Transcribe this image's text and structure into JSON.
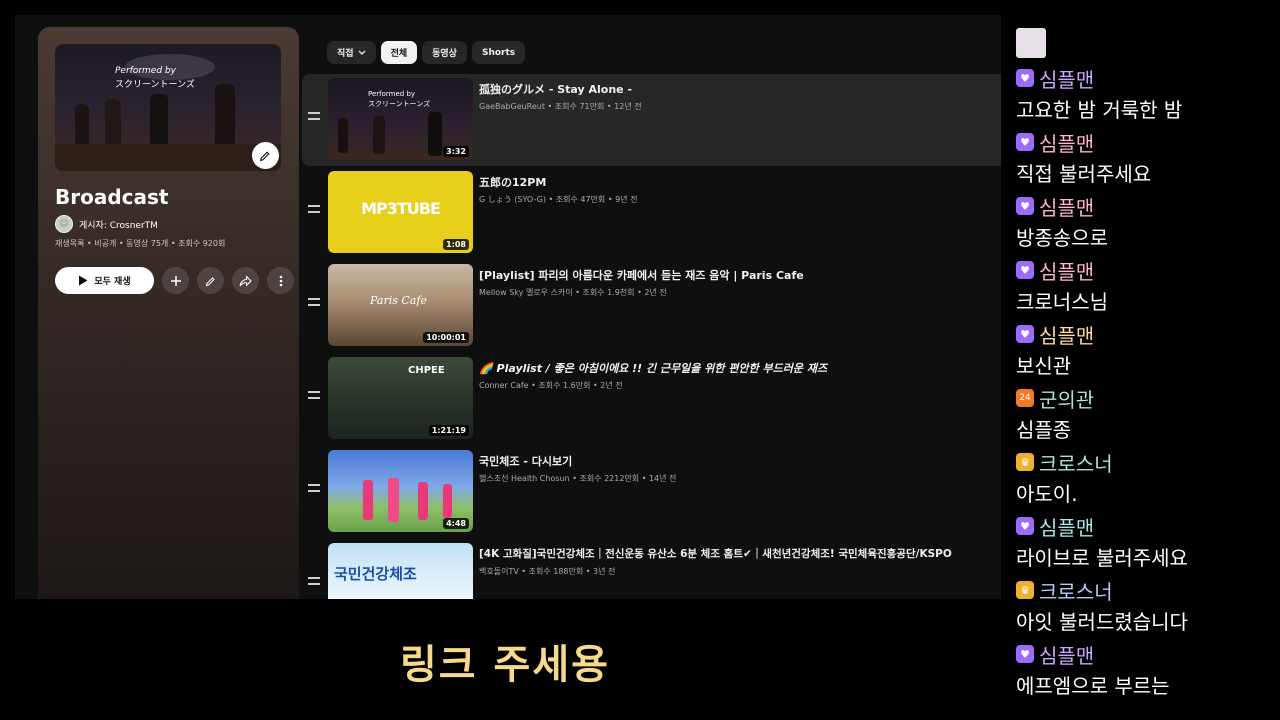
{
  "playlist": {
    "title": "Broadcast",
    "owner": "게시자: CrosnerTM",
    "meta": "재생목록 • 비공개 • 동영상 75개 • 조회수 920회",
    "play_all_label": "모두 재생"
  },
  "chips": [
    {
      "label": "직접"
    },
    {
      "label": "전체"
    },
    {
      "label": "동영상"
    },
    {
      "label": "Shorts"
    }
  ],
  "videos": [
    {
      "title": "孤独のグルメ - Stay Alone -",
      "meta": "GaeBabGeuReut • 조회수 71만회 • 12년 전",
      "duration": "3:32",
      "thumb_text": "Performed by\nスクリーントーンズ"
    },
    {
      "title": "五郎の12PM",
      "meta": "G しょう (SYO-G) • 조회수 47만회 • 9년 전",
      "duration": "1:08",
      "thumb_text": "MP3TUBE"
    },
    {
      "title": "[Playlist] 파리의 아름다운 카페에서 듣는 재즈 음악 | Paris Cafe",
      "meta": "Mellow Sky 멜로우 스카이 • 조회수 1.9천회 • 2년 전",
      "duration": "10:00:01",
      "thumb_text": "Paris Cafe"
    },
    {
      "title": "🌈 Playlist / 좋은 아침이에요 !! 긴 근무일을 위한 편안한 부드러운 재즈",
      "meta": "Conner Cafe • 조회수 1.6만회 • 2년 전",
      "duration": "1:21:19",
      "thumb_text": "CHPEE"
    },
    {
      "title": "국민체조 - 다시보기",
      "meta": "헬스조선 Health Chosun • 조회수 2212만회 • 14년 전",
      "duration": "4:48",
      "thumb_text": ""
    },
    {
      "title": "[4K 고화질]국민건강체조｜전신운동 유산소 6분 체조 홈트✔｜새천년건강체조! 국민체육진흥공단/KSPO",
      "meta": "백호돌이TV • 조회수 188만회 • 3년 전",
      "duration": "",
      "thumb_text": "국민건강체조"
    }
  ],
  "chat": [
    {
      "user": "심플맨",
      "badge": "heart",
      "text": "고요한 밤 거룩한 밤",
      "color": "#c8a8ff"
    },
    {
      "user": "심플맨",
      "badge": "heart",
      "text": "직접 불러주세요",
      "color": "#ffb3c7"
    },
    {
      "user": "심플맨",
      "badge": "heart",
      "text": "방종송으로",
      "color": "#ffb3c7"
    },
    {
      "user": "심플맨",
      "badge": "heart",
      "text": "크로너스님",
      "color": "#ffb3c7"
    },
    {
      "user": "심플맨",
      "badge": "heart",
      "text": "보신관",
      "color": "#ffd9a0"
    },
    {
      "user": "군의관",
      "badge": "gift",
      "text": "심플종",
      "color": "#a8e6c8"
    },
    {
      "user": "크로스너",
      "badge": "crown",
      "text": "아도이.",
      "color": "#a8e6c8"
    },
    {
      "user": "심플맨",
      "badge": "heart",
      "text": "라이브로 불러주세요",
      "color": "#a8e6e0"
    },
    {
      "user": "크로스너",
      "badge": "crown",
      "text": "아잇 불러드렸습니다",
      "color": "#b8c8ff"
    },
    {
      "user": "심플맨",
      "badge": "heart",
      "text": "에프엠으로 부르는",
      "color": "#c8a8ff"
    }
  ],
  "caption": "링크 주세용"
}
